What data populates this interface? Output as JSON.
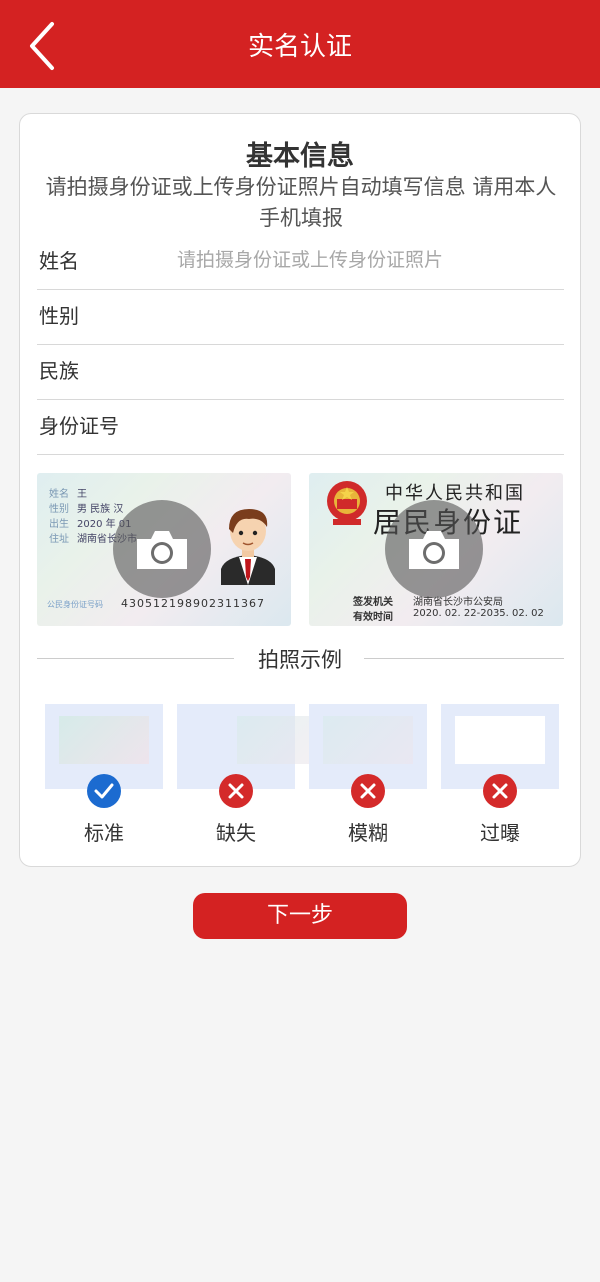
{
  "header": {
    "title": "实名认证",
    "back_icon": "chevron-left-icon",
    "background": "#d42222"
  },
  "card": {
    "title": "基本信息",
    "subtitle": "请拍摄身份证或上传身份证照片自动填写信息 请用本人手机填报",
    "fields": [
      {
        "label": "姓名",
        "placeholder": "请拍摄身份证或上传身份证照片"
      },
      {
        "label": "性别",
        "value": ""
      },
      {
        "label": "民族",
        "value": ""
      },
      {
        "label": "身份证号",
        "value": ""
      }
    ],
    "id_front": {
      "camera_icon": "camera-icon",
      "rows": [
        {
          "key": "姓名",
          "value": "王"
        },
        {
          "key": "性别",
          "value": "男  民族  汉"
        },
        {
          "key": "出生",
          "value": "2020  年  01"
        },
        {
          "key": "住址",
          "value": "湖南省长沙市"
        }
      ],
      "number_label": "公民身份证号码",
      "number": "430512198902311367"
    },
    "id_back": {
      "camera_icon": "camera-icon",
      "emblem_icon": "national-emblem-icon",
      "country": "中华人民共和国",
      "doc_name": "居民身份证",
      "authority_label": "签发机关",
      "authority": "湖南省长沙市公安局",
      "validity_label": "有效时间",
      "validity": "2020. 02. 22-2035. 02. 02"
    },
    "examples_title": "拍照示例",
    "examples": [
      {
        "label": "标准",
        "status": "ok",
        "icon": "check-icon"
      },
      {
        "label": "缺失",
        "status": "bad",
        "icon": "close-icon"
      },
      {
        "label": "模糊",
        "status": "bad",
        "icon": "close-icon"
      },
      {
        "label": "过曝",
        "status": "bad",
        "icon": "close-icon"
      }
    ]
  },
  "next_button": {
    "label": "下一步"
  },
  "colors": {
    "accent": "#d42222",
    "ok": "#1c6bd0",
    "bad": "#d42a2a"
  }
}
